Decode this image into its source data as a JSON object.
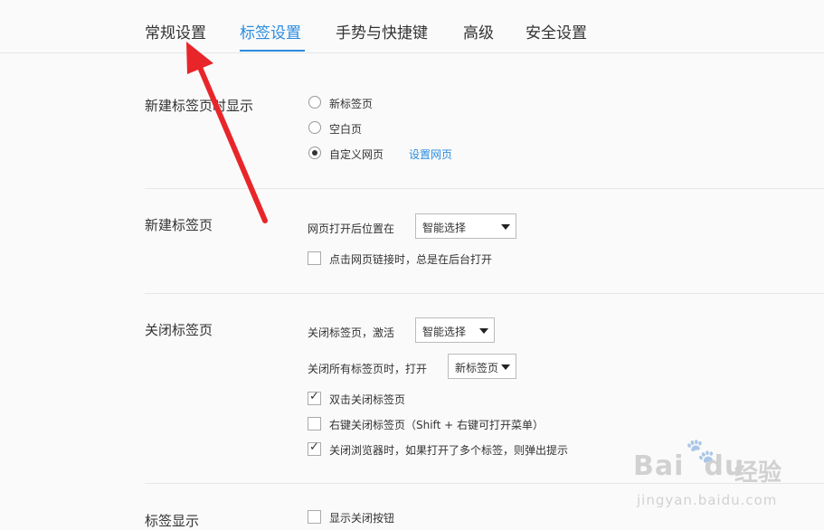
{
  "tabs": [
    {
      "label": "常规设置",
      "active": false
    },
    {
      "label": "标签设置",
      "active": true
    },
    {
      "label": "手势与快捷键",
      "active": false
    },
    {
      "label": "高级",
      "active": false
    },
    {
      "label": "安全设置",
      "active": false
    }
  ],
  "new_tab_display": {
    "title": "新建标签页时显示",
    "options": [
      {
        "label": "新标签页",
        "selected": false
      },
      {
        "label": "空白页",
        "selected": false
      },
      {
        "label": "自定义网页",
        "selected": true
      }
    ],
    "set_page_link": "设置网页"
  },
  "new_tab": {
    "title": "新建标签页",
    "position_label": "网页打开后位置在",
    "position_value": "智能选择",
    "bg_open_label": "点击网页链接时，总是在后台打开",
    "bg_open_checked": false
  },
  "close_tab": {
    "title": "关闭标签页",
    "activate_label": "关闭标签页，激活",
    "activate_value": "智能选择",
    "close_all_label": "关闭所有标签页时，打开",
    "close_all_value": "新标签页",
    "options": [
      {
        "label": "双击关闭标签页",
        "checked": true
      },
      {
        "label": "右键关闭标签页（Shift + 右键可打开菜单）",
        "checked": false
      },
      {
        "label": "关闭浏览器时，如果打开了多个标签，则弹出提示",
        "checked": true
      }
    ]
  },
  "tab_display": {
    "title": "标签显示",
    "show_close_label": "显示关闭按钮",
    "show_close_checked": false
  },
  "annotation": {
    "color": "#e8262a"
  },
  "watermark": {
    "brand": "Bai",
    "brand_suffix": "du",
    "cn": "经验",
    "url": "jingyan.baidu.com"
  }
}
